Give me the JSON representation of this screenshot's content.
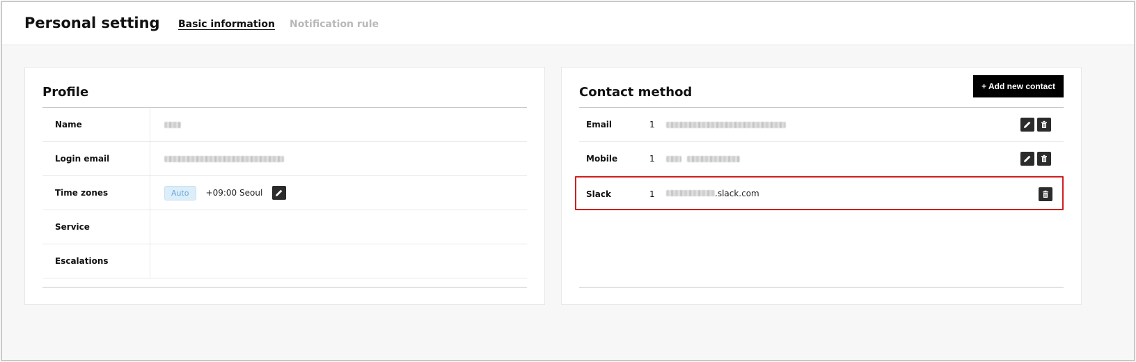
{
  "header": {
    "title": "Personal setting",
    "tabs": [
      {
        "label": "Basic information",
        "active": true
      },
      {
        "label": "Notification rule",
        "active": false
      }
    ]
  },
  "profile": {
    "title": "Profile",
    "rows": [
      {
        "label": "Name"
      },
      {
        "label": "Login email"
      },
      {
        "label": "Time zones",
        "badge": "Auto",
        "value": "+09:00 Seoul"
      },
      {
        "label": "Service"
      },
      {
        "label": "Escalations"
      }
    ]
  },
  "contact": {
    "title": "Contact method",
    "add_button": "+ Add new contact",
    "rows": [
      {
        "label": "Email",
        "priority": "1"
      },
      {
        "label": "Mobile",
        "priority": "1"
      },
      {
        "label": "Slack",
        "priority": "1",
        "value_suffix": ".slack.com"
      }
    ]
  },
  "icons": {
    "edit": "pencil-icon",
    "delete": "trash-icon"
  },
  "colors": {
    "highlight": "#d01e1e",
    "badge_bg": "#dceefa",
    "badge_text": "#6aa7d6",
    "button_bg": "#000000"
  }
}
